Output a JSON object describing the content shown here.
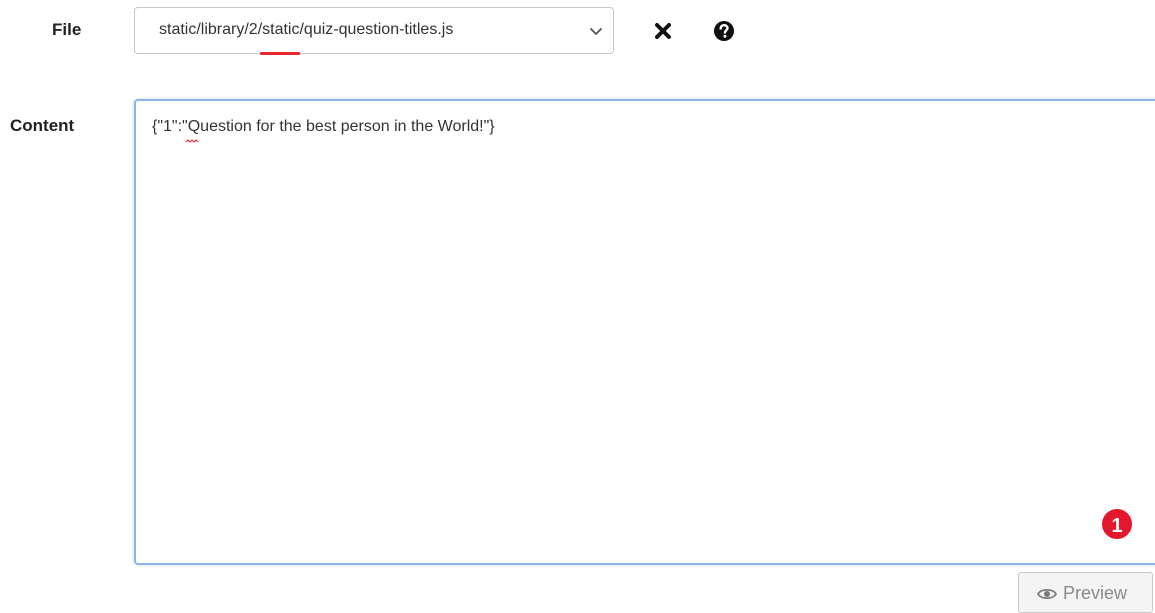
{
  "form": {
    "file_label": "File",
    "content_label": "Content"
  },
  "file_select": {
    "selected_value": "static/library/2/static/quiz-question-titles.js"
  },
  "content_editor": {
    "value": "{\"1\":\"Question for the best person in the World!\"}"
  },
  "annotation": {
    "badge_number": "1",
    "badge_color": "#e3182d",
    "underline_color": "#e8262b"
  },
  "actions": {
    "preview_label": "Preview"
  },
  "icons": {
    "remove": "close-icon",
    "help": "question-circle-icon",
    "preview": "eye-icon",
    "dropdown": "chevron-down-icon"
  }
}
